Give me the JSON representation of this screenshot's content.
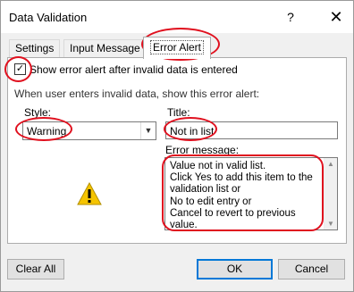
{
  "window": {
    "title": "Data Validation",
    "help_glyph": "?",
    "close_glyph": "✕"
  },
  "tabs": [
    {
      "label": "Settings"
    },
    {
      "label": "Input Message"
    },
    {
      "label": "Error Alert",
      "active": true
    }
  ],
  "show_alert": {
    "checked": true,
    "label": "Show error alert after invalid data is entered"
  },
  "section_label": "When user enters invalid data, show this error alert:",
  "style": {
    "label": "Style:",
    "value": "Warning"
  },
  "title_field": {
    "label": "Title:",
    "value": "Not in list"
  },
  "error_message": {
    "label": "Error message:",
    "lines": [
      "Value not in valid list.",
      "Click Yes  to add this item to the",
      "validation list or",
      "No to edit entry or",
      "Cancel to revert to previous",
      "value."
    ]
  },
  "icon": "warning-icon",
  "buttons": {
    "clear_all": "Clear All",
    "ok": "OK",
    "cancel": "Cancel"
  },
  "colors": {
    "annotation": "#e0101e",
    "accent": "#0078d7"
  }
}
